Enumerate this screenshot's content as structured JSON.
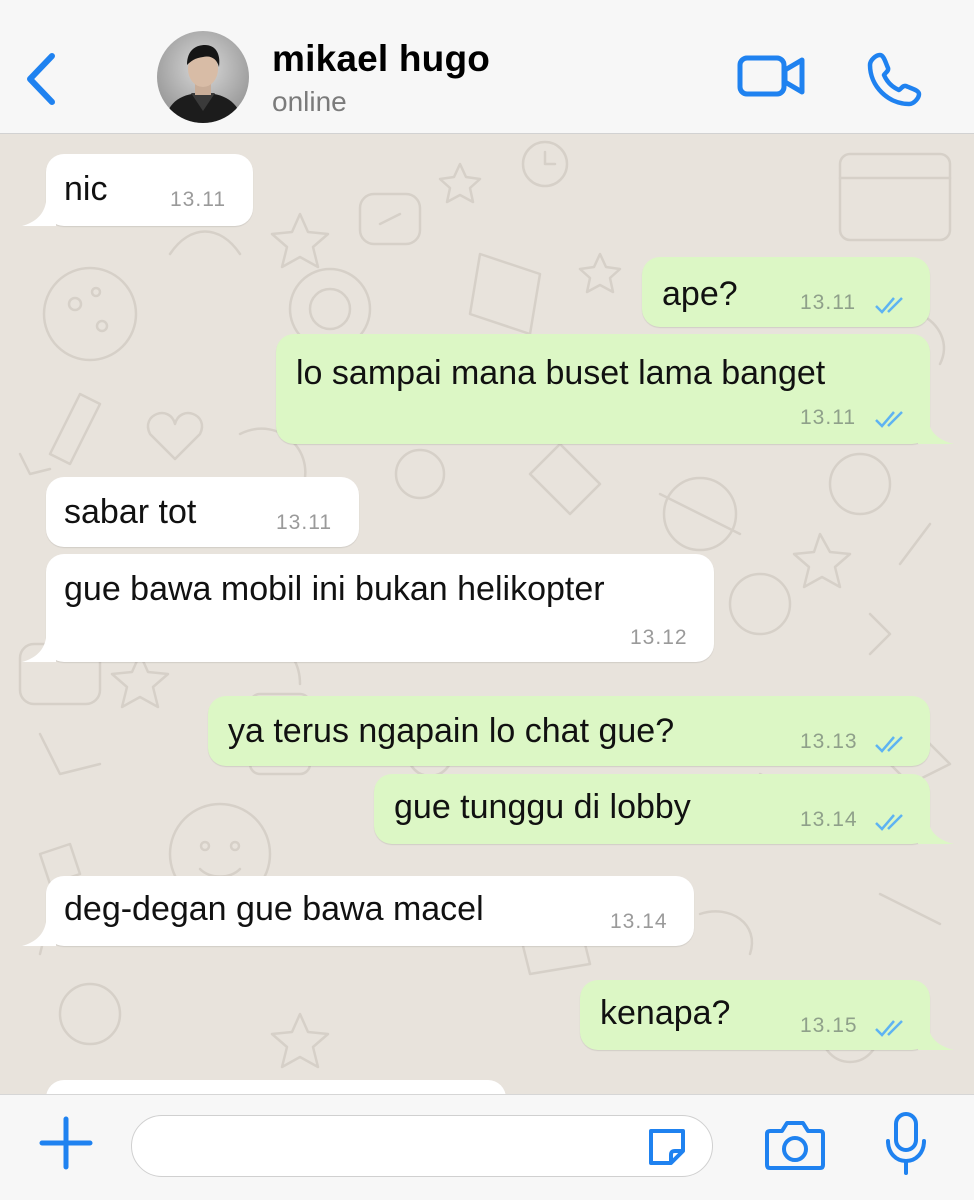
{
  "header": {
    "contact_name": "mikael hugo",
    "status": "online",
    "back_icon": "chevron-left-icon",
    "video_icon": "video-camera-icon",
    "call_icon": "phone-icon"
  },
  "messages": [
    {
      "direction": "in",
      "text": "nic",
      "time": "13.11"
    },
    {
      "direction": "out",
      "text": "ape?",
      "time": "13.11",
      "status": "read"
    },
    {
      "direction": "out",
      "text": "lo sampai mana buset lama banget",
      "time": "13.11",
      "status": "read"
    },
    {
      "direction": "in",
      "text": "sabar tot",
      "time": "13.11"
    },
    {
      "direction": "in",
      "text": "gue bawa mobil ini bukan helikopter",
      "time": "13.12"
    },
    {
      "direction": "out",
      "text": "ya terus ngapain lo chat gue?",
      "time": "13.13",
      "status": "read"
    },
    {
      "direction": "out",
      "text": "gue tunggu di lobby",
      "time": "13.14",
      "status": "read"
    },
    {
      "direction": "in",
      "text": "deg-degan gue bawa macel",
      "time": "13.14"
    },
    {
      "direction": "out",
      "text": "kenapa?",
      "time": "13.15",
      "status": "read"
    }
  ],
  "input": {
    "value": "",
    "placeholder": "",
    "plus_icon": "plus-icon",
    "sticker_icon": "sticker-icon",
    "camera_icon": "camera-icon",
    "mic_icon": "microphone-icon"
  },
  "colors": {
    "accent": "#1f82f0",
    "incoming_bubble": "#ffffff",
    "outgoing_bubble": "#dcf7c5",
    "read_ticks": "#5eb3f2",
    "wallpaper": "#e8e3dc"
  }
}
